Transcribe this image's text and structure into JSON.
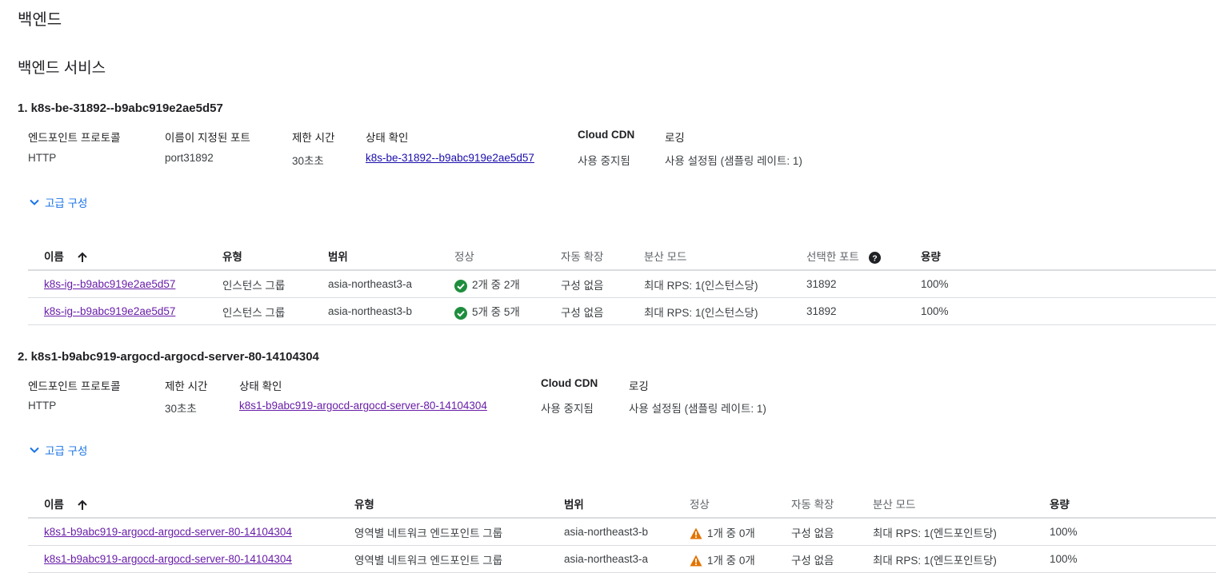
{
  "page": {
    "title": "백엔드",
    "section_title": "백엔드 서비스"
  },
  "services": [
    {
      "title": "1. k8s-be-31892--b9abc919e2ae5d57",
      "meta_headers": [
        "엔드포인트 프로토콜",
        "이름이 지정된 포트",
        "제한 시간",
        "상태 확인",
        "Cloud CDN",
        "로깅"
      ],
      "meta_values": [
        "HTTP",
        "port31892",
        "30초초",
        "k8s-be-31892--b9abc919e2ae5d57",
        "사용 중지됨",
        "사용 설정됨 (샘플링 레이트: 1)"
      ],
      "advanced_label": "고급 구성",
      "table": {
        "headers": [
          "이름",
          "유형",
          "범위",
          "정상",
          "자동 확장",
          "분산 모드",
          "선택한 포트",
          "용량"
        ],
        "rows": [
          [
            "k8s-ig--b9abc919e2ae5d57",
            "인스턴스 그룹",
            "asia-northeast3-a",
            "2개 중 2개",
            "구성 없음",
            "최대 RPS: 1(인스턴스당)",
            "31892",
            "100%"
          ],
          [
            "k8s-ig--b9abc919e2ae5d57",
            "인스턴스 그룹",
            "asia-northeast3-b",
            "5개 중 5개",
            "구성 없음",
            "최대 RPS: 1(인스턴스당)",
            "31892",
            "100%"
          ]
        ]
      }
    },
    {
      "title": "2. k8s1-b9abc919-argocd-argocd-server-80-14104304",
      "meta_headers": [
        "엔드포인트 프로토콜",
        "제한 시간",
        "상태 확인",
        "Cloud CDN",
        "로깅"
      ],
      "meta_values": [
        "HTTP",
        "30초초",
        "k8s1-b9abc919-argocd-argocd-server-80-14104304",
        "사용 중지됨",
        "사용 설정됨 (샘플링 레이트: 1)"
      ],
      "advanced_label": "고급 구성",
      "table": {
        "headers": [
          "이름",
          "유형",
          "범위",
          "정상",
          "자동 확장",
          "분산 모드",
          "용량"
        ],
        "rows": [
          [
            "k8s1-b9abc919-argocd-argocd-server-80-14104304",
            "영역별 네트워크 엔드포인트 그룹",
            "asia-northeast3-b",
            "1개 중 0개",
            "구성 없음",
            "최대 RPS: 1(엔드포인트당)",
            "100%"
          ],
          [
            "k8s1-b9abc919-argocd-argocd-server-80-14104304",
            "영역별 네트워크 엔드포인트 그룹",
            "asia-northeast3-a",
            "1개 중 0개",
            "구성 없음",
            "최대 RPS: 1(엔드포인트당)",
            "100%"
          ]
        ]
      }
    }
  ],
  "colors": {
    "link": "#1a0dab",
    "visited_link": "#681da8",
    "accent": "#1a73e8",
    "ok": "#1e8e3e",
    "warning": "#e37400",
    "border": "#dadce0"
  },
  "icons": {
    "expand": "chevron-down-icon",
    "sort": "arrow-up-icon",
    "healthy": "check-circle-icon",
    "warning": "warning-icon",
    "help": "help-icon"
  }
}
